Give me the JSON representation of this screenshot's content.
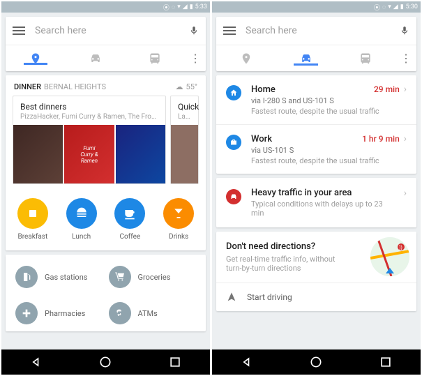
{
  "statusbar": {
    "time_left": "5:33",
    "time_right": "5:30"
  },
  "search": {
    "placeholder": "Search here"
  },
  "tabs_left_active": 0,
  "tabs_right_active": 1,
  "dinner": {
    "title": "DINNER",
    "location": "BERNAL HEIGHTS",
    "temp": "55°",
    "cards": [
      {
        "title": "Best dinners",
        "subtitle": "PizzaHacker, Fumi Curry & Ramen, The Front..."
      },
      {
        "title": "Quick",
        "subtitle": "La Alt"
      }
    ]
  },
  "quick": [
    {
      "label": "Breakfast",
      "color": "#fbbc04"
    },
    {
      "label": "Lunch",
      "color": "#1e88e5"
    },
    {
      "label": "Coffee",
      "color": "#1e88e5"
    },
    {
      "label": "Drinks",
      "color": "#fb8c00"
    }
  ],
  "nearby": [
    {
      "label": "Gas stations"
    },
    {
      "label": "Groceries"
    },
    {
      "label": "Pharmacies"
    },
    {
      "label": "ATMs"
    }
  ],
  "destinations": [
    {
      "name": "Home",
      "time": "29 min",
      "via": "via I-280 S and US-101 S",
      "note": "Fastest route, despite the usual traffic",
      "color": "#1e88e5"
    },
    {
      "name": "Work",
      "time": "1 hr 9 min",
      "via": "via US-101 S",
      "note": "Fastest route, despite the usual traffic",
      "color": "#1e88e5"
    }
  ],
  "traffic": {
    "title": "Heavy traffic in your area",
    "subtitle": "Typical conditions with delays up to 23 min"
  },
  "nodir": {
    "title": "Don't need directions?",
    "subtitle": "Get real-time traffic info, without turn-by-turn directions",
    "start": "Start driving"
  }
}
